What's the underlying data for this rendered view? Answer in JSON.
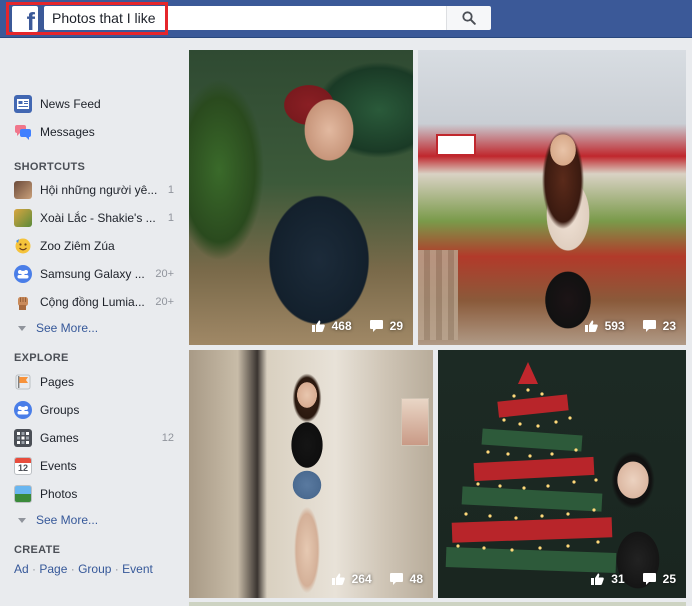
{
  "search": {
    "value": "Photos that I like"
  },
  "sidebar": {
    "main": [
      {
        "label": "News Feed",
        "icon": "news-feed-icon"
      },
      {
        "label": "Messages",
        "icon": "messages-icon"
      }
    ],
    "shortcuts_title": "SHORTCUTS",
    "shortcuts": [
      {
        "label": "Hội những người yê...",
        "count": "1"
      },
      {
        "label": "Xoài Lắc - Shakie's ...",
        "count": "1"
      },
      {
        "label": "Zoo Ziêm Zúa",
        "count": ""
      },
      {
        "label": "Samsung Galaxy ...",
        "count": "20+"
      },
      {
        "label": "Cộng đồng Lumia...",
        "count": "20+"
      }
    ],
    "see_more_1": "See More...",
    "explore_title": "EXPLORE",
    "explore": [
      {
        "label": "Pages",
        "count": ""
      },
      {
        "label": "Groups",
        "count": ""
      },
      {
        "label": "Games",
        "count": "12"
      },
      {
        "label": "Events",
        "count": ""
      },
      {
        "label": "Photos",
        "count": ""
      }
    ],
    "see_more_2": "See More...",
    "create_title": "CREATE",
    "create_links": [
      "Ad",
      "Page",
      "Group",
      "Event"
    ]
  },
  "photos": [
    {
      "likes": "468",
      "comments": "29"
    },
    {
      "likes": "593",
      "comments": "23"
    },
    {
      "likes": "264",
      "comments": "48"
    },
    {
      "likes": "31",
      "comments": "25"
    }
  ],
  "colors": {
    "brand": "#3b5998",
    "highlight": "#e5262b",
    "link": "#365899"
  }
}
